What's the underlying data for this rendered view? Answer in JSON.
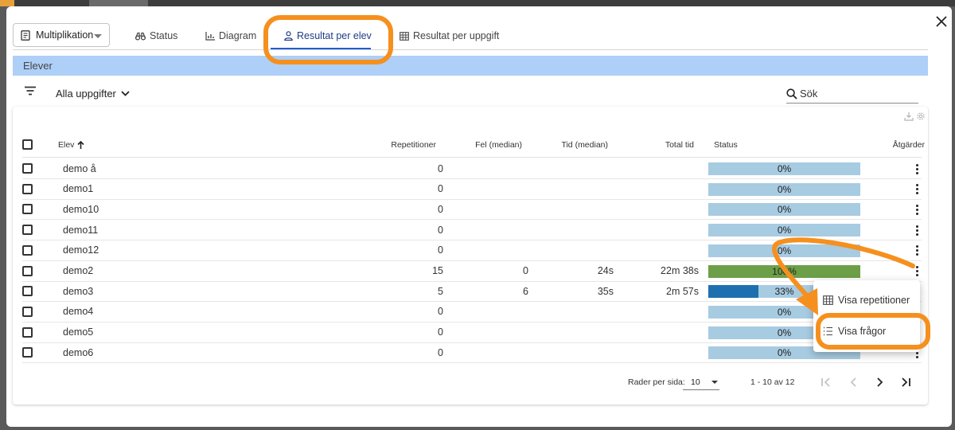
{
  "dialog": {
    "selected_exercise": "Multiplikation",
    "tabs": [
      {
        "label": "Status",
        "icon": "binoculars-icon"
      },
      {
        "label": "Diagram",
        "icon": "bar-chart-icon"
      },
      {
        "label": "Resultat per elev",
        "icon": "person-icon"
      },
      {
        "label": "Resultat per uppgift",
        "icon": "table-icon"
      }
    ],
    "active_tab": "Resultat per elev"
  },
  "section": {
    "title": "Elever"
  },
  "filter": {
    "dropdown_label": "Alla uppgifter"
  },
  "search": {
    "placeholder": "Sök",
    "value": ""
  },
  "table": {
    "columns": {
      "student": "Elev",
      "repetitions": "Repetitioner",
      "errors": "Fel (median)",
      "time": "Tid (median)",
      "total_time": "Total tid",
      "status": "Status",
      "actions": "Åtgärder"
    },
    "sort_column": "Elev",
    "sort_direction": "ascending",
    "rows": [
      {
        "name": "demo å",
        "repetitions": "0",
        "errors": "",
        "time": "",
        "total": "",
        "status_text": "0%",
        "progress": 0
      },
      {
        "name": "demo1",
        "repetitions": "0",
        "errors": "",
        "time": "",
        "total": "",
        "status_text": "0%",
        "progress": 0
      },
      {
        "name": "demo10",
        "repetitions": "0",
        "errors": "",
        "time": "",
        "total": "",
        "status_text": "0%",
        "progress": 0
      },
      {
        "name": "demo11",
        "repetitions": "0",
        "errors": "",
        "time": "",
        "total": "",
        "status_text": "0%",
        "progress": 0
      },
      {
        "name": "demo12",
        "repetitions": "0",
        "errors": "",
        "time": "",
        "total": "",
        "status_text": "0%",
        "progress": 0
      },
      {
        "name": "demo2",
        "repetitions": "15",
        "errors": "0",
        "time": "24s",
        "total": "22m 38s",
        "status_text": "100%",
        "progress": 1.0
      },
      {
        "name": "demo3",
        "repetitions": "5",
        "errors": "6",
        "time": "35s",
        "total": "2m 57s",
        "status_text": "33%",
        "progress": 0.33
      },
      {
        "name": "demo4",
        "repetitions": "0",
        "errors": "",
        "time": "",
        "total": "",
        "status_text": "0%",
        "progress": 0
      },
      {
        "name": "demo5",
        "repetitions": "0",
        "errors": "",
        "time": "",
        "total": "",
        "status_text": "0%",
        "progress": 0
      },
      {
        "name": "demo6",
        "repetitions": "0",
        "errors": "",
        "time": "",
        "total": "",
        "status_text": "0%",
        "progress": 0
      }
    ]
  },
  "pagination": {
    "rows_per_page_label": "Rader per sida:",
    "rows_per_page": "10",
    "range": "1 - 10 av 12"
  },
  "context_menu": {
    "items": [
      {
        "label": "Visa repetitioner",
        "icon": "table-icon"
      },
      {
        "label": "Visa frågor",
        "icon": "list-icon"
      }
    ]
  },
  "colors": {
    "accent": "#1f5bd1",
    "section_bar": "#aecff7",
    "bar_background": "#a7cbe1",
    "complete_fill": "#6d9f48",
    "partial_fill": "#1e6fb0",
    "highlight": "#f5901e"
  }
}
